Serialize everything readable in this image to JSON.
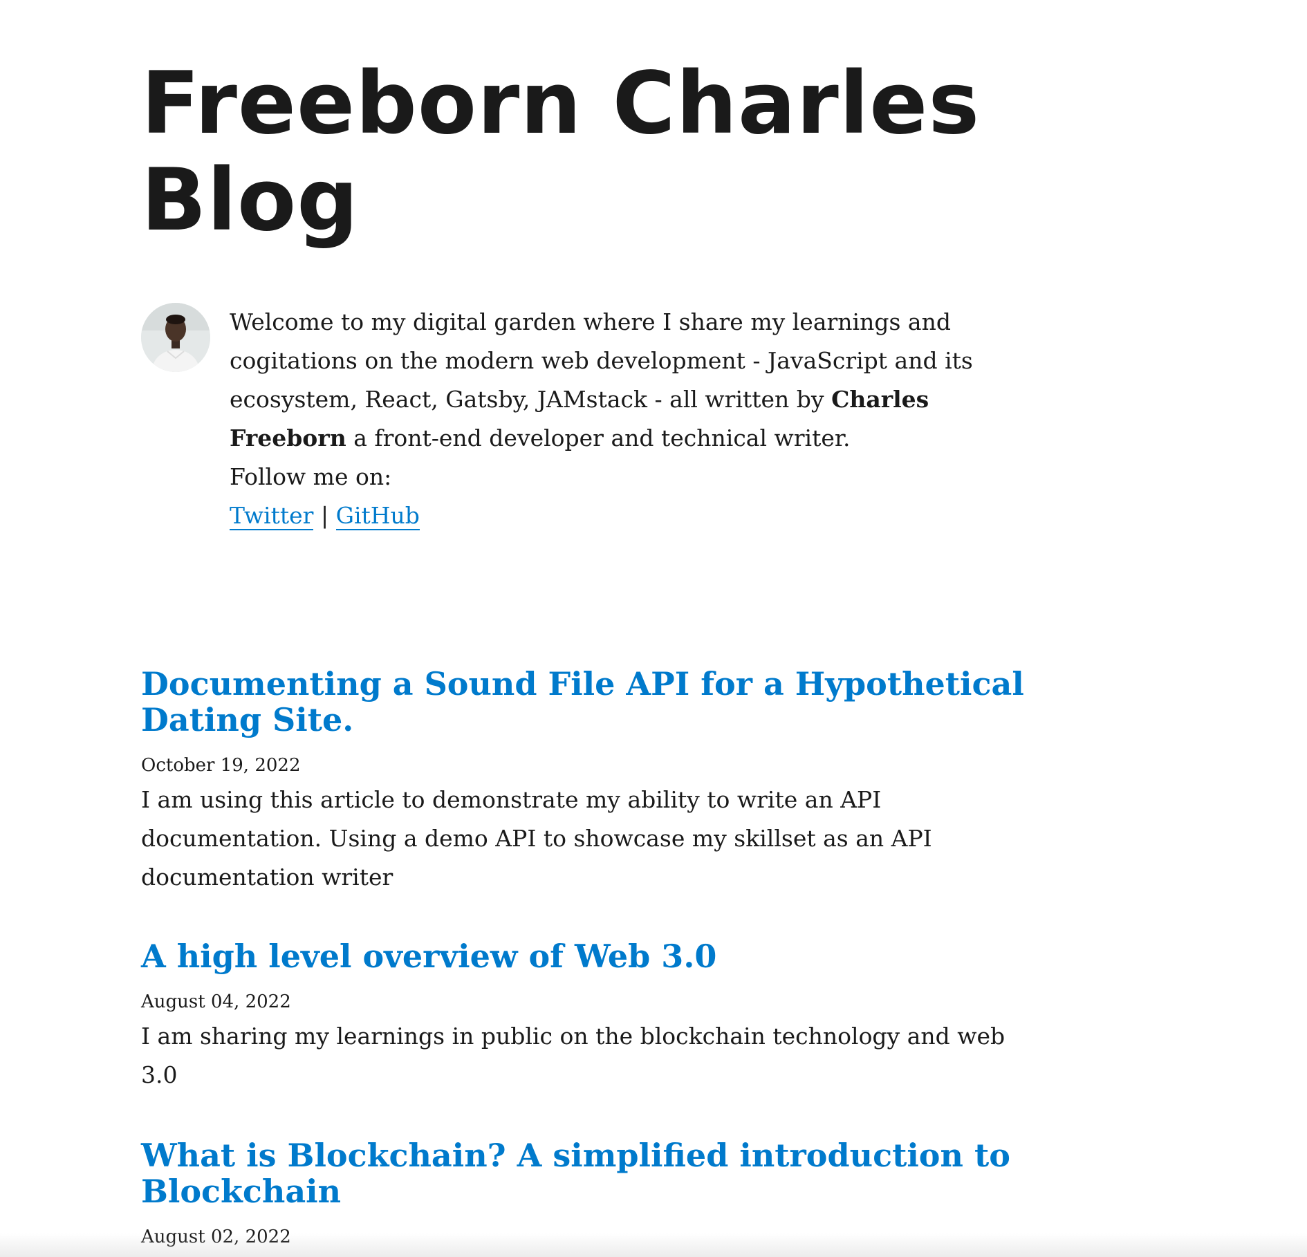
{
  "site": {
    "title": "Freeborn Charles Blog"
  },
  "bio": {
    "avatar_alt": "author-avatar",
    "text_before": "Welcome to my digital garden where I share my learnings and cogitations on the modern web development - JavaScript and its ecosystem, React, Gatsby, JAMstack - all written by ",
    "author_name": "Charles Freeborn",
    "text_after": " a front-end developer and technical writer.",
    "follow_label": "Follow me on:",
    "twitter_label": "Twitter",
    "separator": "|",
    "github_label": "GitHub"
  },
  "posts": [
    {
      "title": "Documenting a Sound File API for a Hypothetical Dating Site.",
      "date": "October 19, 2022",
      "excerpt": "I am using this article to demonstrate my ability to write an API documentation. Using a demo API to showcase my skillset as an API documentation writer"
    },
    {
      "title": "A high level overview of Web 3.0",
      "date": "August 04, 2022",
      "excerpt": "I am sharing my learnings in public on the blockchain technology and web 3.0"
    },
    {
      "title": "What is Blockchain? A simplified introduction to Blockchain",
      "date": "August 02, 2022",
      "excerpt": ""
    }
  ],
  "colors": {
    "link": "#007acc",
    "text": "#1a1a1a",
    "background": "#ffffff"
  }
}
